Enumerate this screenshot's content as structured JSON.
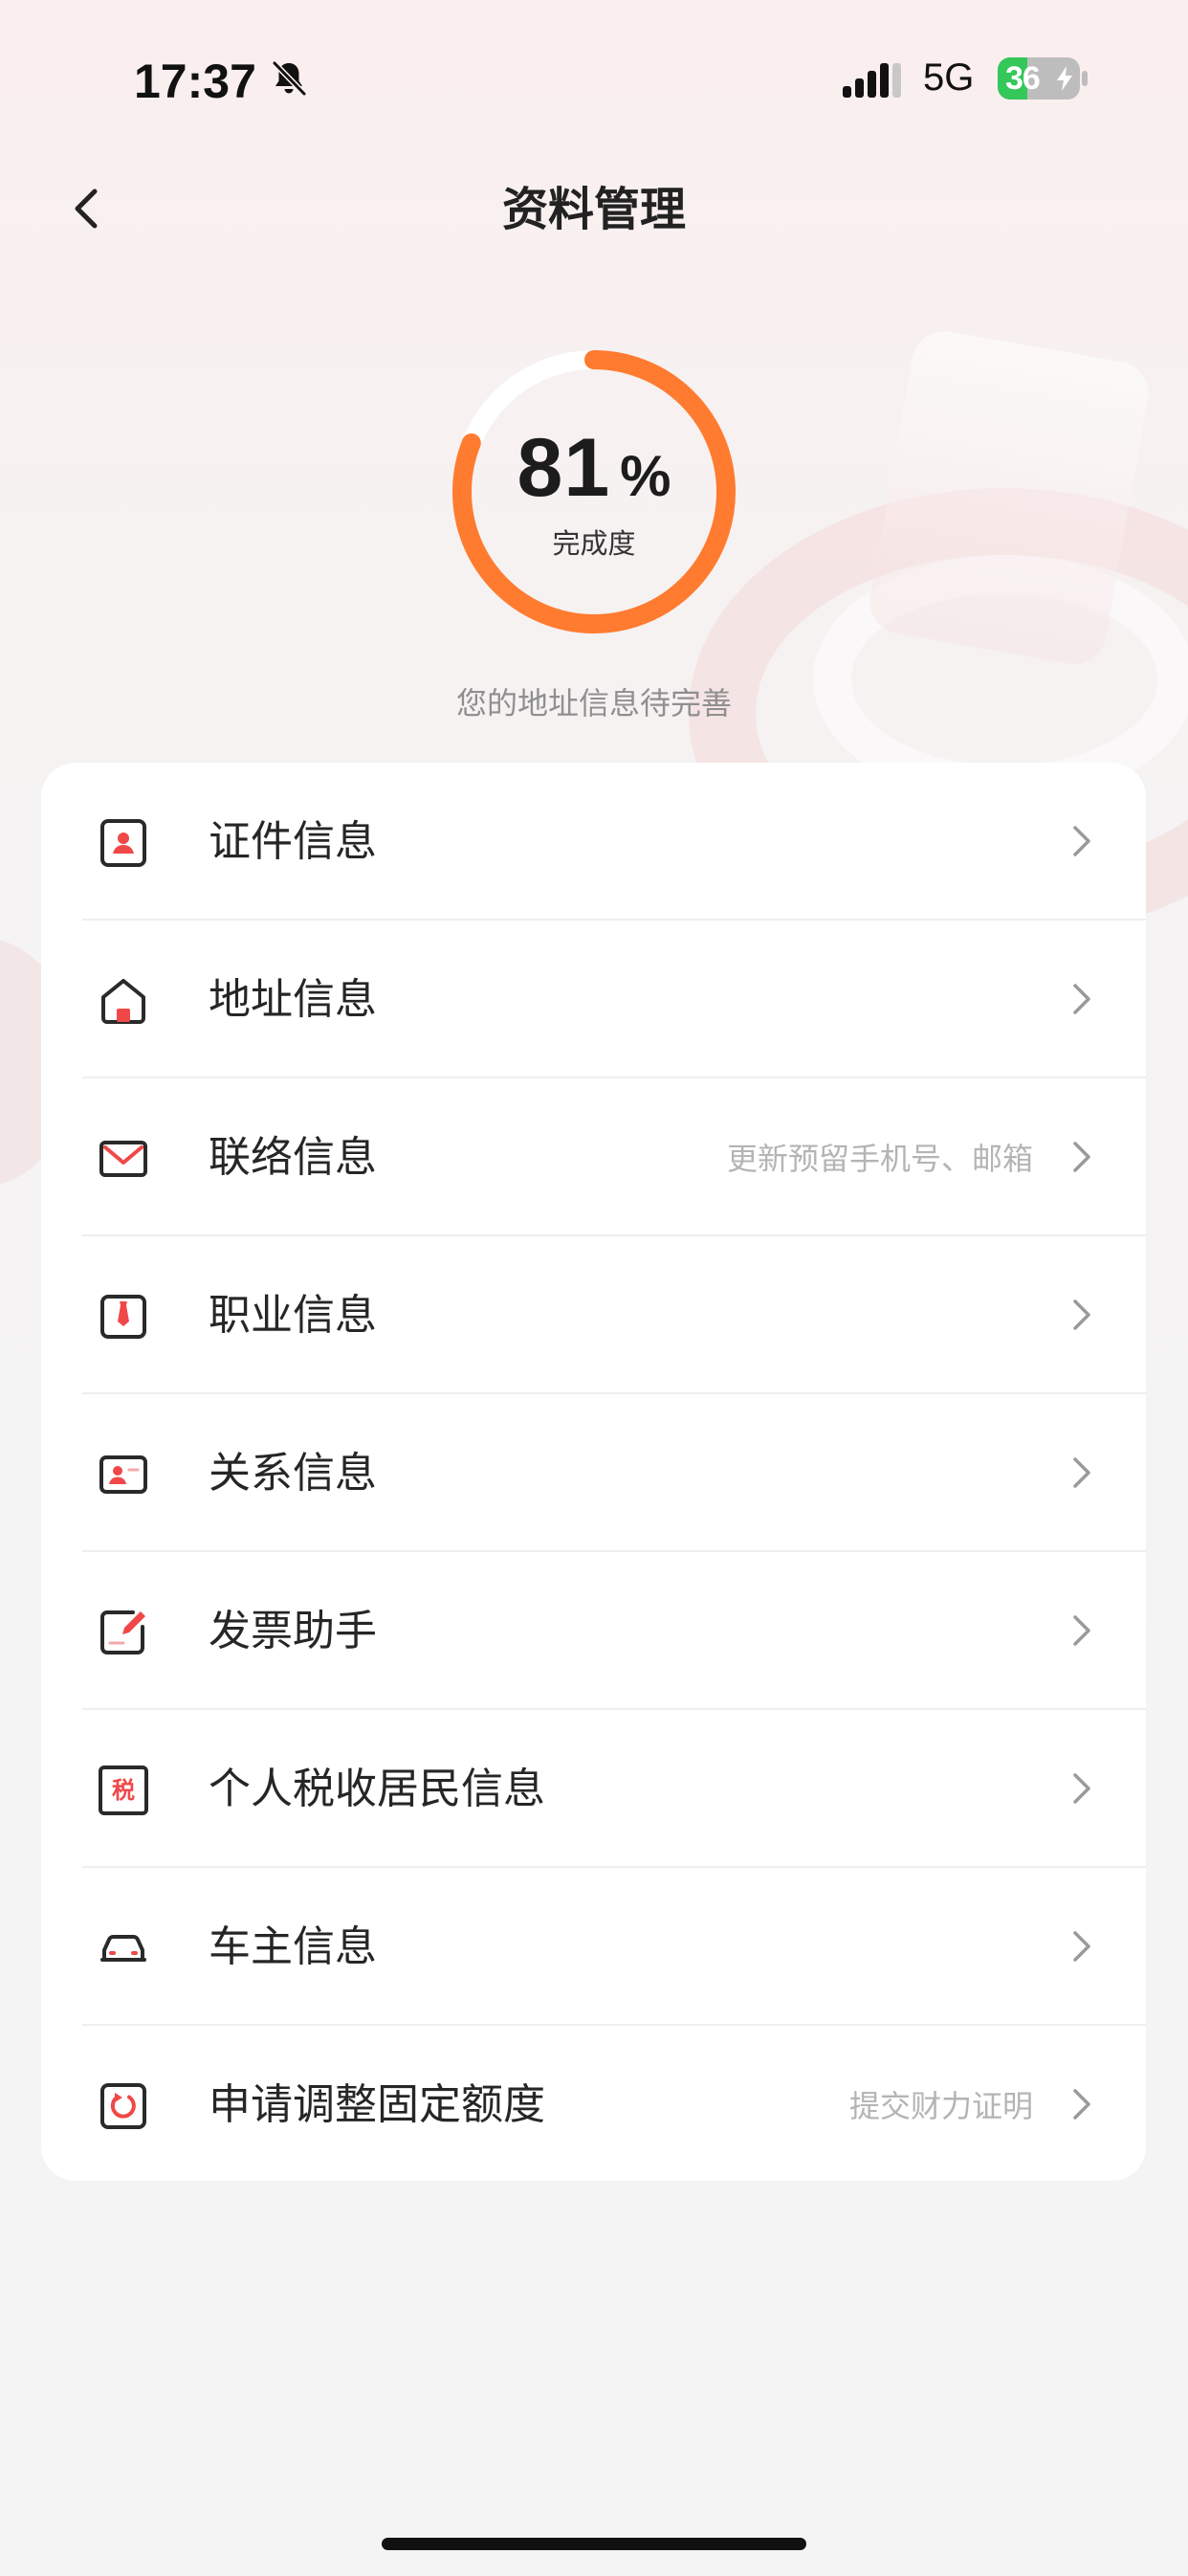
{
  "status_bar": {
    "time": "17:37",
    "network": "5G",
    "battery": "36",
    "battery_level": 0.36
  },
  "header": {
    "title": "资料管理"
  },
  "completion": {
    "value": "81",
    "unit": "%",
    "label": "完成度",
    "progress": 0.81,
    "tip": "您的地址信息待完善"
  },
  "theme": {
    "accent": "#ff7b2f",
    "accent_light": "#fde7dc",
    "icon_red": "#f04848",
    "icon_dark": "#2a2a2a",
    "battery_green": "#34c759"
  },
  "menu": {
    "items": [
      {
        "label": "证件信息",
        "hint": "",
        "icon": "id-card-icon"
      },
      {
        "label": "地址信息",
        "hint": "",
        "icon": "house-icon"
      },
      {
        "label": "联络信息",
        "hint": "更新预留手机号、邮箱",
        "icon": "mail-icon"
      },
      {
        "label": "职业信息",
        "hint": "",
        "icon": "tie-icon"
      },
      {
        "label": "关系信息",
        "hint": "",
        "icon": "contact-card-icon"
      },
      {
        "label": "发票助手",
        "hint": "",
        "icon": "invoice-icon"
      },
      {
        "label": "个人税收居民信息",
        "hint": "",
        "icon": "tax-icon",
        "icon_text": "税"
      },
      {
        "label": "车主信息",
        "hint": "",
        "icon": "car-icon"
      },
      {
        "label": "申请调整固定额度",
        "hint": "提交财力证明",
        "icon": "quota-adjust-icon"
      }
    ]
  }
}
